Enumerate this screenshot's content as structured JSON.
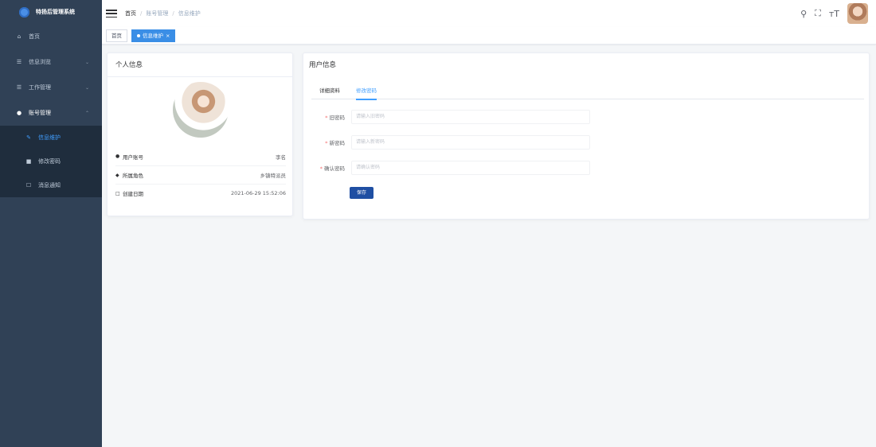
{
  "app": {
    "title": "特扬后管理系统"
  },
  "sidebar": {
    "items": [
      {
        "label": "首页",
        "icon": "home-icon"
      },
      {
        "label": "信息浏览",
        "icon": "menu-icon"
      },
      {
        "label": "工作管理",
        "icon": "menu-icon"
      },
      {
        "label": "账号管理",
        "icon": "user-icon"
      }
    ],
    "sub_items": [
      {
        "label": "信息维护",
        "icon": "edit-icon",
        "active": true
      },
      {
        "label": "修改密码",
        "icon": "lock-icon"
      },
      {
        "label": "消息通知",
        "icon": "message-icon"
      }
    ]
  },
  "breadcrumb": {
    "home": "首页",
    "level1": "账号管理",
    "level2": "信息维护"
  },
  "tags": {
    "home": "首页",
    "active": "信息维护"
  },
  "profile_card": {
    "title": "个人信息",
    "rows": [
      {
        "label": "用户账号",
        "value": "李名"
      },
      {
        "label": "所属角色",
        "value": "乡镇特派员"
      },
      {
        "label": "创建日期",
        "value": "2021-06-29 15:52:06"
      }
    ]
  },
  "user_card": {
    "title": "用户信息",
    "tabs": [
      "详细资料",
      "修改密码"
    ],
    "active_tab": 1,
    "form": {
      "old_label": "旧密码",
      "old_placeholder": "请输入旧密码",
      "new_label": "新密码",
      "new_placeholder": "请输入新密码",
      "confirm_label": "确认密码",
      "confirm_placeholder": "请确认密码"
    },
    "save_label": "保存"
  },
  "colors": {
    "sidebar": "#304156",
    "submenu": "#1f2d3d",
    "accent": "#409eff",
    "button": "#1f4fa3"
  }
}
